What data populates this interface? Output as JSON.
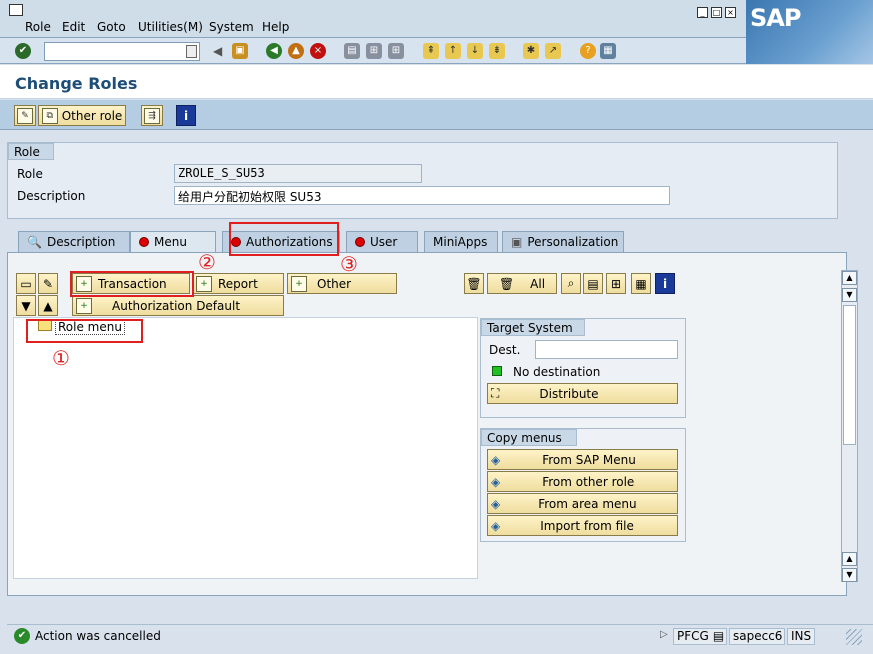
{
  "menu": {
    "items": [
      "Role",
      "Edit",
      "Goto",
      "Utilities(M)",
      "System",
      "Help"
    ]
  },
  "logo": "SAP",
  "title": "Change Roles",
  "apptoolbar": {
    "other_role": "Other role"
  },
  "role_group": {
    "header": "Role",
    "role_label": "Role",
    "role_value": "ZROLE_S_SU53",
    "desc_label": "Description",
    "desc_value": "给用户分配初始权限 SU53"
  },
  "tabs": [
    "Description",
    "Menu",
    "Authorizations",
    "User",
    "MiniApps",
    "Personalization"
  ],
  "menu_tab": {
    "transaction": "Transaction",
    "report": "Report",
    "other": "Other",
    "auth_default": "Authorization Default",
    "all": "All",
    "tree_root": "Role menu"
  },
  "target_system": {
    "header": "Target System",
    "dest_label": "Dest.",
    "dest_value": "",
    "status": "No destination",
    "distribute": "Distribute"
  },
  "copy_menus": {
    "header": "Copy menus",
    "buttons": [
      "From SAP Menu",
      "From other role",
      "From area menu",
      "Import from file"
    ]
  },
  "annotations": {
    "one": "①",
    "two": "②",
    "three": "③"
  },
  "status": {
    "message": "Action was cancelled",
    "tcode": "PFCG",
    "server": "sapecc6",
    "mode": "INS"
  },
  "colors": {
    "title": "#1d4e77",
    "highlight": "#e02020",
    "ok_light": "#22c022"
  }
}
